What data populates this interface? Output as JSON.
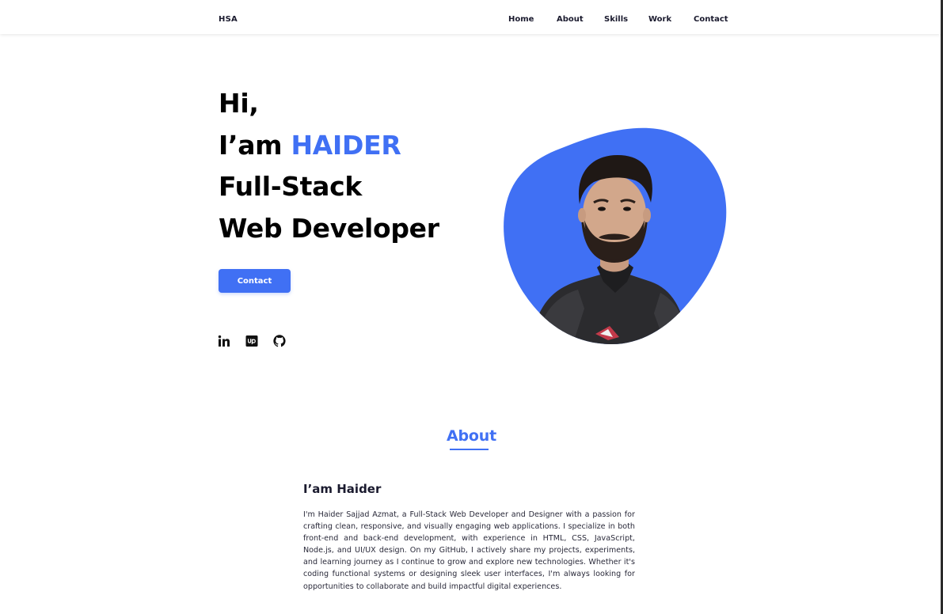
{
  "header": {
    "logo": "HSA",
    "nav": [
      "Home",
      "About",
      "Skills",
      "Work",
      "Contact"
    ]
  },
  "hero": {
    "line1": "Hi,",
    "line2_prefix": "I’am ",
    "line2_name": "HAIDER",
    "line3": "Full-Stack",
    "line4": "Web Developer",
    "button_label": "Contact",
    "social_icons": [
      "linkedin-icon",
      "upwork-icon",
      "github-icon"
    ]
  },
  "colors": {
    "accent": "#4070f4",
    "text_dark": "#1a1a2e"
  },
  "about": {
    "section_title": "About",
    "heading": "I’am Haider",
    "paragraph": "I'm Haider Sajjad Azmat, a Full-Stack Web Developer and Designer with a passion for crafting clean, responsive, and visually engaging web applications. I specialize in both front-end and back-end development, with experience in HTML, CSS, JavaScript, Node.js, and UI/UX design. On my GitHub, I actively share my projects, experiments, and learning journey as I continue to grow and explore new technologies. Whether it's coding functional systems or designing sleek user interfaces, I'm always looking for opportunities to collaborate and build impactful digital experiences."
  }
}
